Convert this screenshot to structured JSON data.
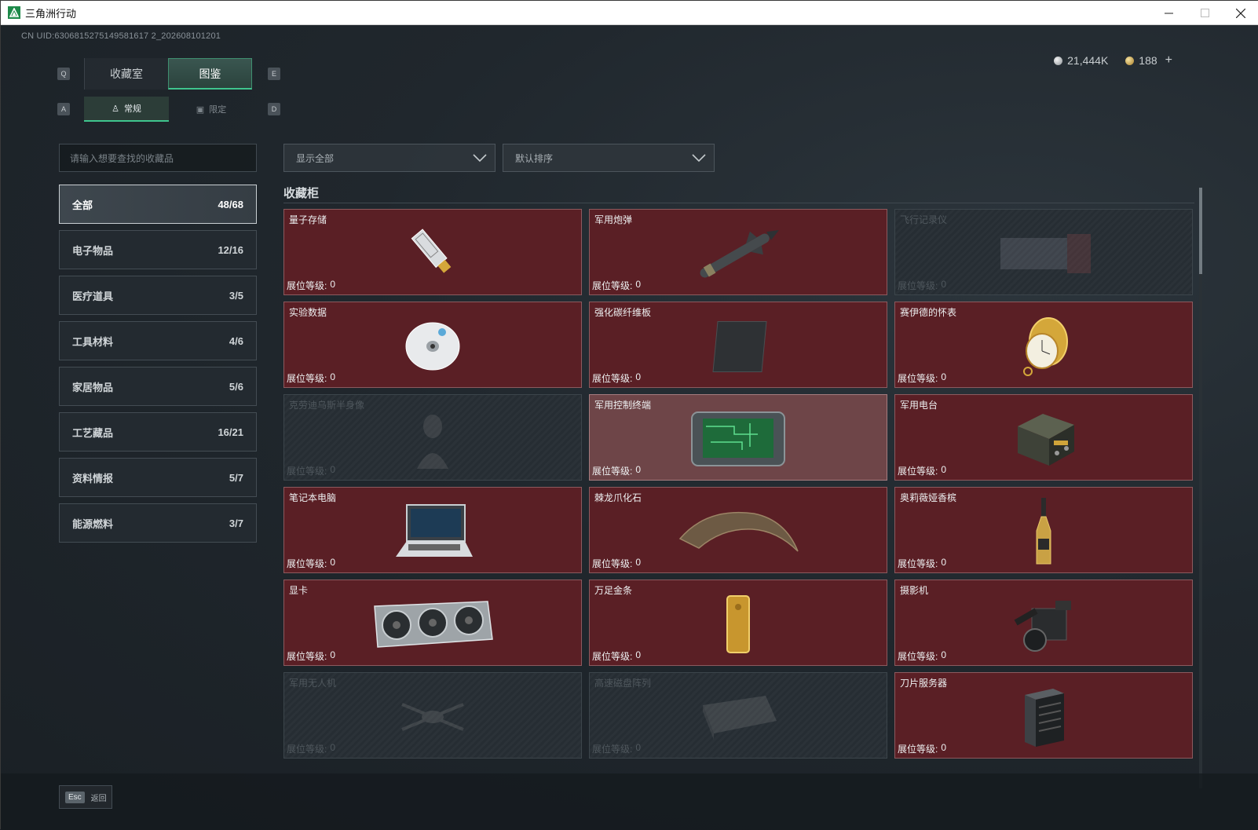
{
  "window": {
    "title": "三角洲行动"
  },
  "uid": "CN UID:6306815275149581617 2_202608101201",
  "currency": {
    "silver": "21,444K",
    "gold": "188",
    "plus": "+"
  },
  "keys": {
    "prev_tab": "Q",
    "next_tab": "E",
    "prev_sub": "A",
    "next_sub": "D"
  },
  "main_tabs": [
    {
      "label": "收藏室"
    },
    {
      "label": "图鉴"
    }
  ],
  "sub_tabs": [
    {
      "label": "常规"
    },
    {
      "label": "限定"
    }
  ],
  "search": {
    "placeholder": "请输入想要查找的收藏品"
  },
  "filters": {
    "show": "显示全部",
    "sort": "默认排序"
  },
  "categories": [
    {
      "label": "全部",
      "count": "48/68"
    },
    {
      "label": "电子物品",
      "count": "12/16"
    },
    {
      "label": "医疗道具",
      "count": "3/5"
    },
    {
      "label": "工具材料",
      "count": "4/6"
    },
    {
      "label": "家居物品",
      "count": "5/6"
    },
    {
      "label": "工艺藏品",
      "count": "16/21"
    },
    {
      "label": "资料情报",
      "count": "5/7"
    },
    {
      "label": "能源燃料",
      "count": "3/7"
    }
  ],
  "section": {
    "title": "收藏柜"
  },
  "level_label": "展位等级:",
  "items": [
    {
      "name": "量子存储",
      "level": "0",
      "icon": "usb-drive-icon"
    },
    {
      "name": "军用炮弹",
      "level": "0",
      "icon": "missile-icon"
    },
    {
      "name": "飞行记录仪",
      "level": "0",
      "icon": "flight-recorder-icon"
    },
    {
      "name": "实验数据",
      "level": "0",
      "icon": "disc-icon"
    },
    {
      "name": "强化碳纤维板",
      "level": "0",
      "icon": "carbon-plate-icon"
    },
    {
      "name": "赛伊德的怀表",
      "level": "0",
      "icon": "pocket-watch-icon"
    },
    {
      "name": "克劳迪乌斯半身像",
      "level": "0",
      "icon": "bust-icon"
    },
    {
      "name": "军用控制终端",
      "level": "0",
      "icon": "control-terminal-icon"
    },
    {
      "name": "军用电台",
      "level": "0",
      "icon": "radio-icon"
    },
    {
      "name": "笔记本电脑",
      "level": "0",
      "icon": "laptop-icon"
    },
    {
      "name": "棘龙爪化石",
      "level": "0",
      "icon": "claw-fossil-icon"
    },
    {
      "name": "奥莉薇娅香槟",
      "level": "0",
      "icon": "champagne-icon"
    },
    {
      "name": "显卡",
      "level": "0",
      "icon": "graphics-card-icon"
    },
    {
      "name": "万足金条",
      "level": "0",
      "icon": "gold-bar-icon"
    },
    {
      "name": "摄影机",
      "level": "0",
      "icon": "camera-icon"
    },
    {
      "name": "军用无人机",
      "level": "0",
      "icon": "drone-icon"
    },
    {
      "name": "高速磁盘阵列",
      "level": "0",
      "icon": "disk-array-icon"
    },
    {
      "name": "刀片服务器",
      "level": "0",
      "icon": "blade-server-icon"
    }
  ],
  "footer": {
    "esc_key": "Esc",
    "back_label": "返回"
  }
}
